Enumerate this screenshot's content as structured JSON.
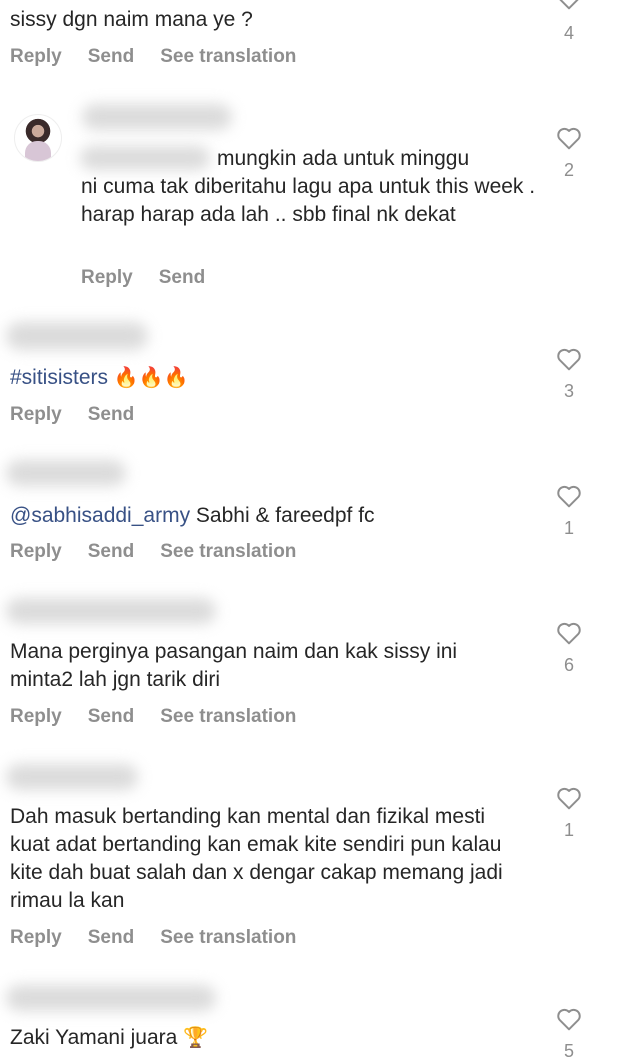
{
  "comments": [
    {
      "text": "sissy dgn naim mana ye ?",
      "actions": {
        "reply": "Reply",
        "send": "Send",
        "translate": "See translation"
      },
      "likes": "4"
    },
    {
      "text_line1": "mungkin ada untuk minggu",
      "text_rest": "ni cuma tak diberitahu lagu apa untuk this week . harap harap ada lah .. sbb final nk dekat",
      "actions": {
        "reply": "Reply",
        "send": "Send"
      },
      "likes": "2"
    },
    {
      "hashtag": "#sitisisters",
      "emoji": "🔥🔥🔥",
      "actions": {
        "reply": "Reply",
        "send": "Send"
      },
      "likes": "3"
    },
    {
      "mention": "@sabhisaddi_army",
      "text": "Sabhi & fareedpf fc",
      "actions": {
        "reply": "Reply",
        "send": "Send",
        "translate": "See translation"
      },
      "likes": "1"
    },
    {
      "text": "Mana perginya pasangan naim dan kak sissy ini minta2 lah jgn tarik diri",
      "actions": {
        "reply": "Reply",
        "send": "Send",
        "translate": "See translation"
      },
      "likes": "6"
    },
    {
      "text": "Dah masuk bertanding kan mental dan fizikal mesti kuat adat bertanding kan  emak kite sendiri pun kalau kite dah buat salah dan x dengar cakap memang jadi rimau la kan",
      "actions": {
        "reply": "Reply",
        "send": "Send",
        "translate": "See translation"
      },
      "likes": "1"
    },
    {
      "text": "Zaki Yamani juara",
      "emoji": "🏆",
      "likes": "5"
    }
  ],
  "icons": {
    "like": "heart-outline-icon"
  },
  "colors": {
    "text": "#262626",
    "muted": "#8e8e8e",
    "mention": "#385185"
  }
}
